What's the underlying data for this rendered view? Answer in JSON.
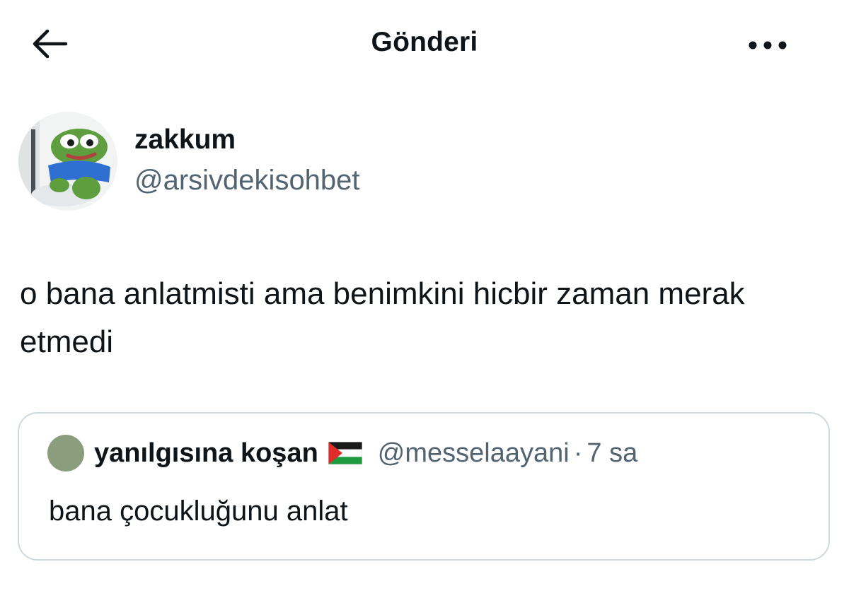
{
  "header": {
    "title": "Gönderi",
    "back_icon": "arrow-left-icon",
    "more_icon": "more-horizontal-icon"
  },
  "author": {
    "display_name": "zakkum",
    "handle": "@arsivdekisohbet",
    "avatar_icon": "frog-avatar"
  },
  "tweet": {
    "text": "o bana anlatmisti ama benimkini hicbir zaman merak etmedi"
  },
  "quoted": {
    "display_name": "yanılgısına koşan",
    "flag_icon": "palestine-flag-icon",
    "handle": "@messelaayani",
    "separator": "·",
    "time": "7 sa",
    "text": "bana çocukluğunu anlat",
    "avatar_color": "#8a9e7d"
  },
  "colors": {
    "text_primary": "#0f1419",
    "text_secondary": "#536471",
    "border": "#cfd9de"
  }
}
